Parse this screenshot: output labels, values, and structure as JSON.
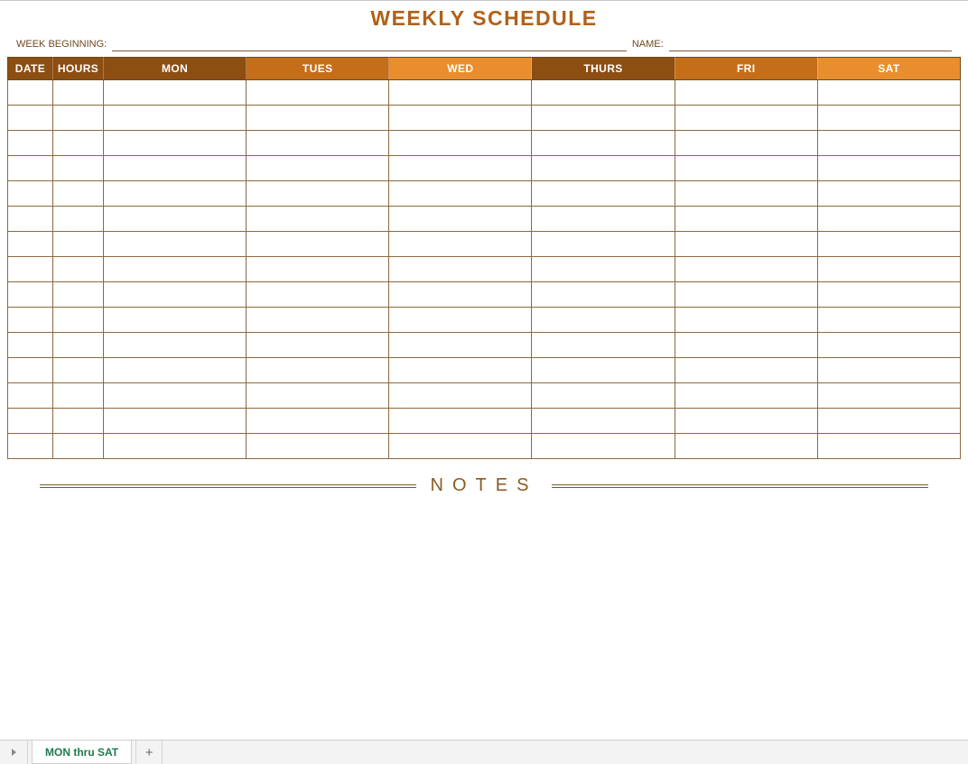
{
  "title": "WEEKLY SCHEDULE",
  "meta": {
    "week_beginning_label": "WEEK BEGINNING:",
    "week_beginning_value": "",
    "name_label": "NAME:",
    "name_value": ""
  },
  "columns": {
    "date": "DATE",
    "hours": "HOURS",
    "mon": "MON",
    "tues": "TUES",
    "wed": "WED",
    "thurs": "THURS",
    "fri": "FRI",
    "sat": "SAT"
  },
  "row_count": 15,
  "notes_label": "NOTES",
  "sheetbar": {
    "active_tab": "MON thru SAT"
  }
}
